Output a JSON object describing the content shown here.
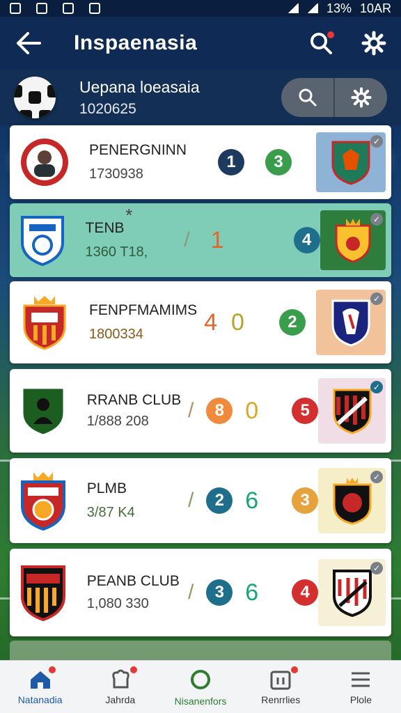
{
  "status_bar": {
    "time": "10AR",
    "battery": "13%"
  },
  "app_bar": {
    "title": "Inspaenasia"
  },
  "header": {
    "title": "Uepana loeasaia",
    "subtitle": "1020625"
  },
  "matches": [
    {
      "team": "PENERGNINN",
      "meta": "1730938",
      "score_a": "1",
      "score_b": "3",
      "a_color": "#1e3a5f",
      "b_color": "#3a9d4b",
      "a_style": "circle",
      "b_style": "circle",
      "tile_bg": "#8fb3d6",
      "star": ""
    },
    {
      "team": "TENB",
      "meta": "1360 T18,",
      "score_a": "1",
      "score_b": "4",
      "a_color": "#e0662f",
      "b_color": "#1f6e8c",
      "a_style": "text",
      "b_style": "circle",
      "tile_bg": "#2f7d3c",
      "star": "*"
    },
    {
      "team": "FENPFMAMIMS",
      "meta": "1800334",
      "score_a": "4",
      "score_b": "0",
      "a_color": "#e0662f",
      "b_color": "#b5a32a",
      "a_style": "text",
      "b_style": "text",
      "extra": "2",
      "extra_color": "#3a9d4b",
      "tile_bg": "#f2c39a",
      "star": ""
    },
    {
      "team": "RRANB CLUB",
      "meta": "1/888 208",
      "score_a": "8",
      "score_b": "0",
      "a_color": "#f08a3c",
      "b_color": "#d6a82b",
      "a_style": "circle",
      "b_style": "text",
      "extra": "5",
      "extra_color": "#d32f2f",
      "tile_bg": "#f1dde6",
      "star": ""
    },
    {
      "team": "PLMB",
      "meta": "3/87 K4",
      "score_a": "2",
      "score_b": "6",
      "a_color": "#1f6e8c",
      "b_color": "#1aa37a",
      "a_style": "circle",
      "b_style": "text",
      "extra": "3",
      "extra_color": "#e6a23c",
      "tile_bg": "#f5eec6",
      "star": ""
    },
    {
      "team": "PEANB CLUB",
      "meta": "1,080 330",
      "score_a": "3",
      "score_b": "6",
      "a_color": "#1f6e8c",
      "b_color": "#1aa37a",
      "a_style": "circle",
      "b_style": "text",
      "extra": "4",
      "extra_color": "#d32f2f",
      "tile_bg": "#f5f0d6",
      "star": ""
    }
  ],
  "bottom_nav": [
    {
      "label": "Natanadia",
      "icon": "home-icon",
      "active": true
    },
    {
      "label": "Jahrda",
      "icon": "chef-icon",
      "active": false
    },
    {
      "label": "Nisanenfors",
      "icon": "circle-icon",
      "active": false
    },
    {
      "label": "Renrrlies",
      "icon": "calendar-icon",
      "active": false
    },
    {
      "label": "Plole",
      "icon": "menu-icon",
      "active": false
    }
  ],
  "colors": {
    "app_bar": "#0f2b55",
    "accent": "#1f5aa6",
    "highlight_card": "#7fcdb7"
  }
}
